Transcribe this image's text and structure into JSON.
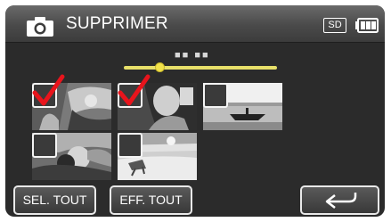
{
  "header": {
    "title": "SUPPRIMER",
    "media_badge": "SD",
    "mode_icon": "camera-icon",
    "battery_icon": "battery-icon"
  },
  "page_indicator": {
    "text": "■■ ■■",
    "position_fraction": 0.22
  },
  "thumbnails": [
    {
      "name": "thumbnail-1",
      "checked": true
    },
    {
      "name": "thumbnail-2",
      "checked": true
    },
    {
      "name": "thumbnail-3",
      "checked": false
    },
    {
      "name": "thumbnail-4",
      "checked": false
    },
    {
      "name": "thumbnail-5",
      "checked": false
    }
  ],
  "buttons": {
    "select_all": "SEL. TOUT",
    "clear_all": "EFF. TOUT",
    "back_icon": "back-arrow-icon"
  },
  "colors": {
    "checkmark": "#e8141c",
    "slider": "#e8e06a"
  }
}
